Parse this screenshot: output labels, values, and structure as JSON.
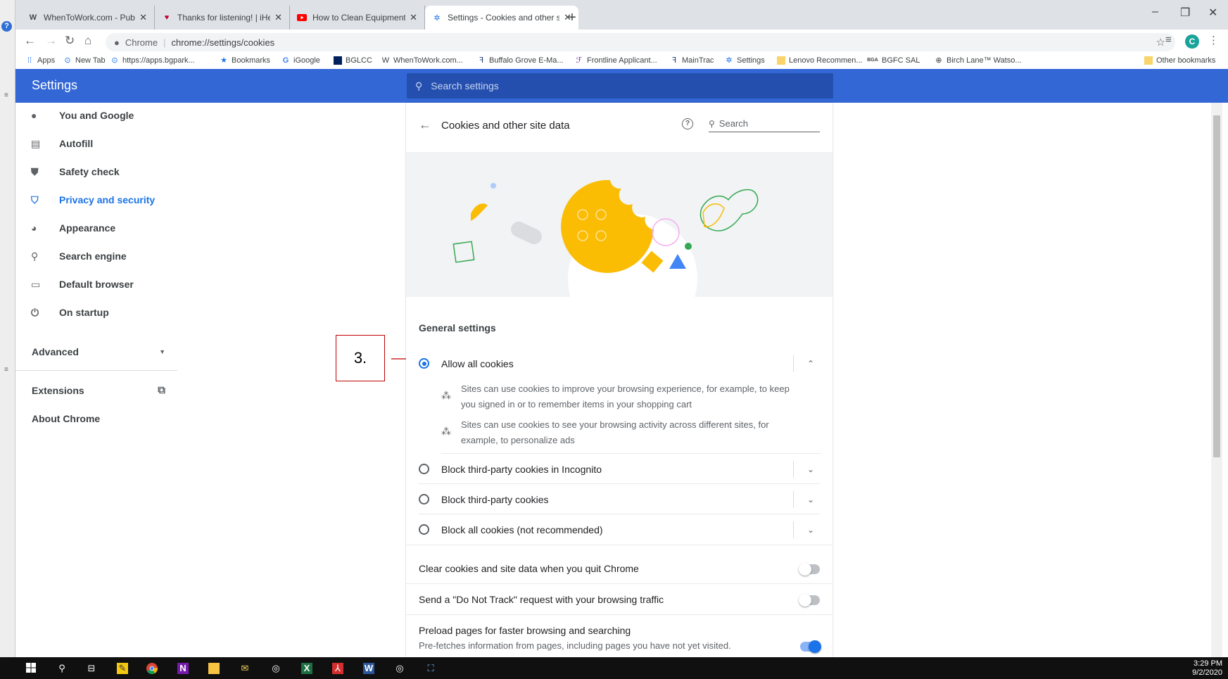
{
  "colors": {
    "brand": "#3367d6",
    "accent": "#1a73e8",
    "annotation": "#c00000"
  },
  "browser": {
    "tabs": [
      {
        "icon": "wordpress-icon",
        "title": "WhenToWork.com - Published Sc"
      },
      {
        "icon": "iheart-icon",
        "title": "Thanks for listening! | iHeart"
      },
      {
        "icon": "youtube-icon",
        "title": "How to Clean Equipment at Lake"
      },
      {
        "icon": "settings-gear-icon",
        "title": "Settings - Cookies and other site"
      }
    ],
    "new_tab": "+",
    "window_controls": [
      "–",
      "❐",
      "✕"
    ],
    "omnibox": {
      "origin": "Chrome",
      "url": "chrome://settings/cookies"
    },
    "profile_initial": "C",
    "bookmarks": [
      {
        "icon": "apps-grid-icon",
        "label": "Apps"
      },
      {
        "icon": "newtab-icon",
        "label": "New Tab"
      },
      {
        "icon": "site-icon",
        "label": "https://apps.bgpark..."
      },
      {
        "icon": "star-icon",
        "label": "Bookmarks"
      },
      {
        "icon": "google-icon",
        "label": "iGoogle"
      },
      {
        "icon": "flag-icon",
        "label": "BGLCC"
      },
      {
        "icon": "wordpress-icon",
        "label": "WhenToWork.com..."
      },
      {
        "icon": "bg-logo-icon",
        "label": "Buffalo Grove E-Ma..."
      },
      {
        "icon": "frontline-icon",
        "label": "Frontline Applicant..."
      },
      {
        "icon": "bg-logo-icon",
        "label": "MainTrac"
      },
      {
        "icon": "gear-icon",
        "label": "Settings"
      },
      {
        "icon": "folder-icon",
        "label": "Lenovo Recommen..."
      },
      {
        "icon": "bga-icon",
        "label": "BGFC SAL"
      },
      {
        "icon": "globe-icon",
        "label": "Birch Lane™ Watso..."
      }
    ],
    "other_bookmarks": "Other bookmarks"
  },
  "settings": {
    "title": "Settings",
    "search_placeholder": "Search settings",
    "nav": [
      {
        "label": "You and Google",
        "icon": "person-icon"
      },
      {
        "label": "Autofill",
        "icon": "clipboard-icon"
      },
      {
        "label": "Safety check",
        "icon": "shield-check-icon"
      },
      {
        "label": "Privacy and security",
        "icon": "shield-icon"
      },
      {
        "label": "Appearance",
        "icon": "palette-icon"
      },
      {
        "label": "Search engine",
        "icon": "search-icon"
      },
      {
        "label": "Default browser",
        "icon": "browser-icon"
      },
      {
        "label": "On startup",
        "icon": "power-icon"
      }
    ],
    "advanced": "Advanced",
    "extensions": "Extensions",
    "about": "About Chrome"
  },
  "page": {
    "title": "Cookies and other site data",
    "search_placeholder": "Search",
    "general_settings": "General settings",
    "options": [
      {
        "label": "Allow all cookies",
        "selected": true,
        "expanded": true
      },
      {
        "label": "Block third-party cookies in Incognito",
        "selected": false
      },
      {
        "label": "Block third-party cookies",
        "selected": false
      },
      {
        "label": "Block all cookies (not recommended)",
        "selected": false
      }
    ],
    "allow_details": [
      "Sites can use cookies to improve your browsing experience, for example, to keep you signed in or to remember items in your shopping cart",
      "Sites can use cookies to see your browsing activity across different sites, for example, to personalize ads"
    ],
    "toggles": [
      {
        "label": "Clear cookies and site data when you quit Chrome",
        "on": false
      },
      {
        "label": "Send a \"Do Not Track\" request with your browsing traffic",
        "on": false
      },
      {
        "label": "Preload pages for faster browsing and searching",
        "sub": "Pre-fetches information from pages, including pages you have not yet visited.",
        "on": true
      }
    ]
  },
  "annotation": {
    "step": "3."
  },
  "taskbar": {
    "icons": [
      "windows-start-icon",
      "search-icon",
      "task-view-icon",
      "sticky-notes-icon",
      "chrome-icon",
      "onenote-icon",
      "file-explorer-icon",
      "mail-icon",
      "app-icon",
      "excel-icon",
      "acrobat-icon",
      "word-icon",
      "app-icon",
      "network-icon"
    ],
    "time": "3:29 PM",
    "date": "9/2/2020"
  }
}
